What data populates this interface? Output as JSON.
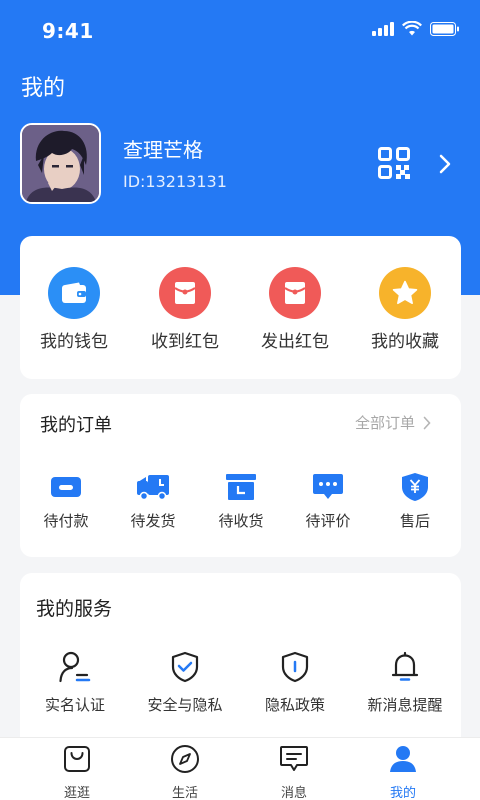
{
  "status_bar": {
    "time": "9:41"
  },
  "header": {
    "title": "我的"
  },
  "profile": {
    "name": "查理芒格",
    "id_text": "ID:13213131"
  },
  "wallet": [
    {
      "label": "我的钱包",
      "icon": "wallet-icon",
      "color": "#2b8ff6"
    },
    {
      "label": "收到红包",
      "icon": "red-packet-icon",
      "color": "#f05a58"
    },
    {
      "label": "发出红包",
      "icon": "red-packet-icon",
      "color": "#f05a58"
    },
    {
      "label": "我的收藏",
      "icon": "star-icon",
      "color": "#f7b32b"
    }
  ],
  "orders": {
    "title": "我的订单",
    "all_label": "全部订单",
    "items": [
      {
        "label": "待付款",
        "icon": "card-icon"
      },
      {
        "label": "待发货",
        "icon": "truck-icon"
      },
      {
        "label": "待收货",
        "icon": "box-icon"
      },
      {
        "label": "待评价",
        "icon": "chat-icon"
      },
      {
        "label": "售后",
        "icon": "shield-yen-icon"
      }
    ]
  },
  "services": {
    "title": "我的服务",
    "items": [
      {
        "label": "实名认证",
        "icon": "user-verify-icon"
      },
      {
        "label": "安全与隐私",
        "icon": "shield-check-icon"
      },
      {
        "label": "隐私政策",
        "icon": "shield-info-icon"
      },
      {
        "label": "新消息提醒",
        "icon": "bell-icon"
      }
    ]
  },
  "tabbar": {
    "items": [
      {
        "label": "逛逛",
        "icon": "bag-icon",
        "active": false
      },
      {
        "label": "生活",
        "icon": "compass-icon",
        "active": false
      },
      {
        "label": "消息",
        "icon": "message-icon",
        "active": false
      },
      {
        "label": "我的",
        "icon": "profile-icon",
        "active": true
      }
    ]
  },
  "colors": {
    "primary": "#2479f4",
    "red": "#f05a58",
    "gold": "#f7b32b"
  }
}
